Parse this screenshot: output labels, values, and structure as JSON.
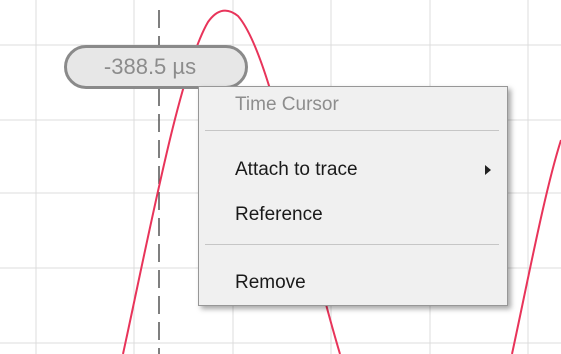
{
  "cursor": {
    "time_label": "-388.5 µs"
  },
  "context_menu": {
    "title": "Time Cursor",
    "items": [
      {
        "label": "Attach to trace",
        "has_submenu": true
      },
      {
        "label": "Reference"
      },
      {
        "label": "Remove"
      }
    ]
  },
  "colors": {
    "trace": "#e8345a",
    "grid": "#dcdcdc",
    "cursor_line": "#555555"
  }
}
